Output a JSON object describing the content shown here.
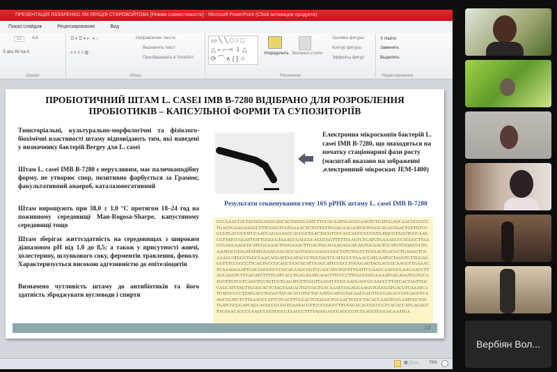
{
  "window": {
    "title": "ПРЕЗЕНТАЦІЯ ЛАЗАРЕНКО ЛМ ЛЕКЦІЯ СТАРОВОЙТОВА [Режим совместимости] - Microsoft PowerPoint (Сбой активации продукта)"
  },
  "menu": [
    "Показ слайдов",
    "Рецензирование",
    "Вид"
  ],
  "ribbon": {
    "font_size": "12",
    "text_direction": "Направление текста",
    "align_text": "Выровнять текст",
    "smartart": "Преобразовать в SmartArt",
    "arrange": "Упорядочить",
    "quick_styles": "Экспресс-стили",
    "shape_fill": "Заливка фигуры",
    "shape_outline": "Контур фигуры",
    "shape_effects": "Эффекты фигур",
    "find": "Найти",
    "replace": "Заменить",
    "select": "Выделить",
    "groups": {
      "font": "Шрифт",
      "paragraph": "Абзац",
      "drawing": "Рисование",
      "editing": "Редактирование"
    }
  },
  "slide": {
    "title": "ПРОБІОТИЧНИЙ ШТАМ L. CASEI IMB B-7280 ВІДІБРАНО ДЛЯ РОЗРОБЛЕННЯ ПРОБІОТИКІВ – КАПСУЛЬНОЇ ФОРМИ ТА СУПОЗИТОРІЇВ",
    "paragraphs": [
      "Тинкторіальні, культурально-морфологічні та фізіолого-біохімічні властивості штаму відповідають тим, які наведені у визначнику бактерій Bergey для L. casei",
      "Штам L. casei IMB B-7280 є нерухливим, має паличкоподібну форму, не утворює спор, позитивно фарбується за Грамом; факультативний анаероб, каталазонегативний",
      "Штам вирощують при 38,0 ± 1,0 °С протягом 18–24 год на поживному середовищі Man-Rogosa-Sharpe, капустяному середовищі тощо",
      "Штам зберігає життєздатність на середовищах з широким діапазоном pH від 1,0 до 8,5; а також у присутності жовчі, холестерину, шлункового соку, ферментів травлення, фенолу. Характеризується високою адгезивністю до епітеліоцитів",
      "Визначено чутливість штаму до антибіотиків та його здатність зброджувати вуглеводи і спирти"
    ],
    "micro_caption": "Електронна мікроскопія бактерій L. casei IMB B-7280, що знаходяться на початку стаціонарної фази росту (масштаб вказано на зображенні ,електронний мікроскоп JEM-1400)",
    "seq_title": "Результати секвенування гену 16S рРНК штаму L. casei IMB B-7280",
    "sequence": "CCCAAACTACTACGGGAGGCAGCAGTAGGGAATCTTCCACAATGGACGCAAGTCTGATGGAGCAACGCCGCGTGAGTGAAGAAGGCTTTCGGGTCGTAAAACTCTGTTGTTGGAGAAGAATGGTCGGCAGAGTAACTGTTGTCGGCGTGACGGTATCCAACCAGAAAGCCACGGCTAACTACGTGCCAGCAGCCGCGGTAATACGTAGGTGGCAAGCGTTATCCGGATTTATTGGGCGTAAAGCGAGCGCAGGCGGTTTTTTAAGTCTGATGTGAAAGCCCTCGGCTTAACCGAGGAAGCGCATCGGAAACTGGGAAACTTGAGTGCAGAAGAGGACAGTGGAACTCCATGTGTAGCGGTGAAATGCGTAGATATATGGAAGAACACCAGTGGCGAAGGCGGCTGTCTGGTCTGTAACTGACGCTGAGGCTCGAAAGCATGGGTAGCGAACAGGATTAGATACCCTGGTAGTCCATGCCGTAAACGATGAATGCTAGGTGTTGGAGGGTTTCCGCCCTTCAGTGCCGCAGCTAACGCATTAAGCATTCCGCCTGGGGAGTACGACCGCAAGGTTGAAACTCAAAGGAATTGACGGGGGCCCGCACAAGCGGTGGAGCATGTGGTTTAATTCGAAGCAACGCGAAGAACCTTACCAGGTCTTGACATCTTTTGATCACCTGAGAGATCAGGTTTCCCCTTCGGGGGCAAAATGACAGGTGGTGCATGGTTGTCGTCAGCTCGTGTCGTGAGATGTTGGGTTAAGTCCCGCAACGAGCGCAACCCTTATGACTAGTTGCCAGCATTTAGTTGGGCACTCTAGTAAGACTGCCGGTGACAAACCGGAGGAAGGTGGGGATGACGTCAAATCATCATGCCCCTTATGACCTGGGCTACACACGTGCTACAATGGATGGTACAACGAGTTGCGAGACCGCGAGGTCAAGCTAATCTCTTAAAGCCATTCTCAGTTCGGACTGTAGGCTGCAACTCGCCTACACGAAGTCGGAATCGCTAGTAATCGCGGATCAGCACGCCGCGGTGAATACGTTCCCGGGCCTTGTACACACCGCCCGTCACACCATGAGAGTTTGTAACACCCGAAGCCGGTGGCGTAACCCTTTTAGGGAGCGAGCCGTCTAAGGTGGGACAAATGA",
    "page_number": "14"
  },
  "status": {
    "zoom": "79%"
  },
  "participants": {
    "name_tile": "Вербіян Вол..."
  }
}
